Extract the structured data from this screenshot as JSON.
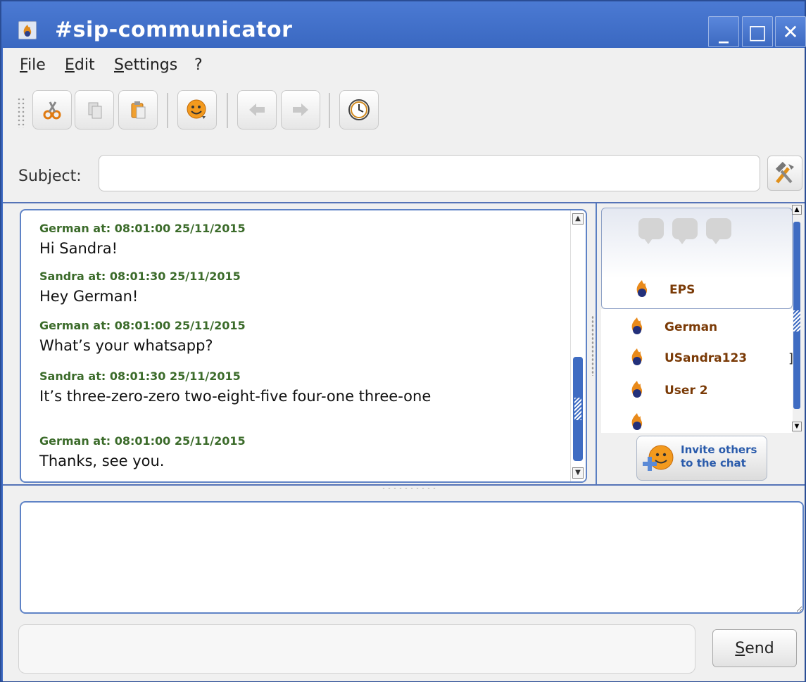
{
  "window": {
    "title": "#sip-communicator",
    "controls": {
      "minimize": "_",
      "maximize": "□",
      "close": "✕"
    }
  },
  "menu": [
    {
      "label": "File",
      "mnemonic": "F",
      "rest": "ile"
    },
    {
      "label": "Edit",
      "mnemonic": "E",
      "rest": "dit"
    },
    {
      "label": "Settings",
      "mnemonic": "S",
      "rest": "ettings"
    },
    {
      "label": "?",
      "mnemonic": "",
      "rest": "?"
    }
  ],
  "toolbar": {
    "buttons": [
      {
        "name": "cut",
        "icon": "scissors-icon",
        "enabled": true
      },
      {
        "name": "copy",
        "icon": "copy-icon",
        "enabled": false
      },
      {
        "name": "paste",
        "icon": "paste-icon",
        "enabled": true
      },
      {
        "name": "smiley",
        "icon": "smiley-icon",
        "enabled": true
      },
      {
        "name": "back",
        "icon": "arrow-left-icon",
        "enabled": false
      },
      {
        "name": "forward",
        "icon": "arrow-right-icon",
        "enabled": false
      },
      {
        "name": "history",
        "icon": "clock-icon",
        "enabled": true
      }
    ]
  },
  "subject": {
    "label": "Subject:",
    "value": "",
    "tool_icon": "tools-icon"
  },
  "messages": [
    {
      "header": "German at: 08:01:00 25/11/2015",
      "text": "Hi Sandra!"
    },
    {
      "header": "Sandra at: 08:01:30 25/11/2015",
      "text": "Hey German!"
    },
    {
      "header": "German at: 08:01:00 25/11/2015",
      "text": "What’s your whatsapp?"
    },
    {
      "header": "Sandra  at: 08:01:30 25/11/2015",
      "text": "It’s three-zero-zero two-eight-five four-one three-one"
    },
    {
      "header": "German at: 08:01:00 25/11/2015",
      "text": "Thanks, see you."
    }
  ],
  "participants": {
    "room": "EPS",
    "list": [
      {
        "name": "German"
      },
      {
        "name": "USandra123",
        "suffix": "]"
      },
      {
        "name": "User 2"
      },
      {
        "name": ""
      }
    ]
  },
  "invite": {
    "line1": "Invite others",
    "line2": "to the chat"
  },
  "write": {
    "value": ""
  },
  "send": {
    "mnemonic": "S",
    "rest": "end",
    "label": "Send"
  },
  "colors": {
    "title_bar": "#3e6bc4",
    "timestamp": "#3b6b2a",
    "contact_name": "#7a3a06",
    "invite_text": "#2a5bab"
  }
}
